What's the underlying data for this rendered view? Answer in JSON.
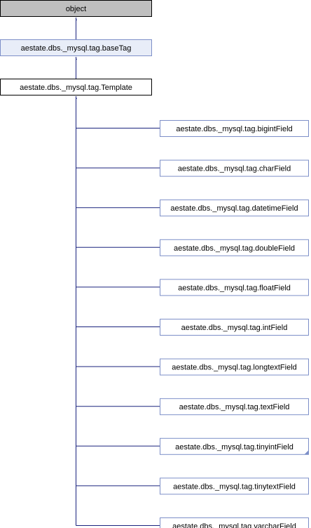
{
  "diagram": {
    "root": {
      "label": "object",
      "fill": "#bfbfbf",
      "stroke": "#000000"
    },
    "base": {
      "label": "aestate.dbs._mysql.tag.baseTag",
      "fill": "#e8edf8",
      "stroke": "#7d8fc8"
    },
    "template": {
      "label": "aestate.dbs._mysql.tag.Template",
      "fill": "#ffffff",
      "stroke": "#000000"
    },
    "children": [
      {
        "label": "aestate.dbs._mysql.tag.bigintField"
      },
      {
        "label": "aestate.dbs._mysql.tag.charField"
      },
      {
        "label": "aestate.dbs._mysql.tag.datetimeField"
      },
      {
        "label": "aestate.dbs._mysql.tag.doubleField"
      },
      {
        "label": "aestate.dbs._mysql.tag.floatField"
      },
      {
        "label": "aestate.dbs._mysql.tag.intField"
      },
      {
        "label": "aestate.dbs._mysql.tag.longtextField"
      },
      {
        "label": "aestate.dbs._mysql.tag.textField"
      },
      {
        "label": "aestate.dbs._mysql.tag.tinyintField",
        "has_more": true
      },
      {
        "label": "aestate.dbs._mysql.tag.tinytextField"
      },
      {
        "label": "aestate.dbs._mysql.tag.varcharField"
      }
    ],
    "child_style": {
      "fill": "#ffffff",
      "stroke": "#7d8fc8"
    },
    "edge_color": "#1a237e"
  }
}
